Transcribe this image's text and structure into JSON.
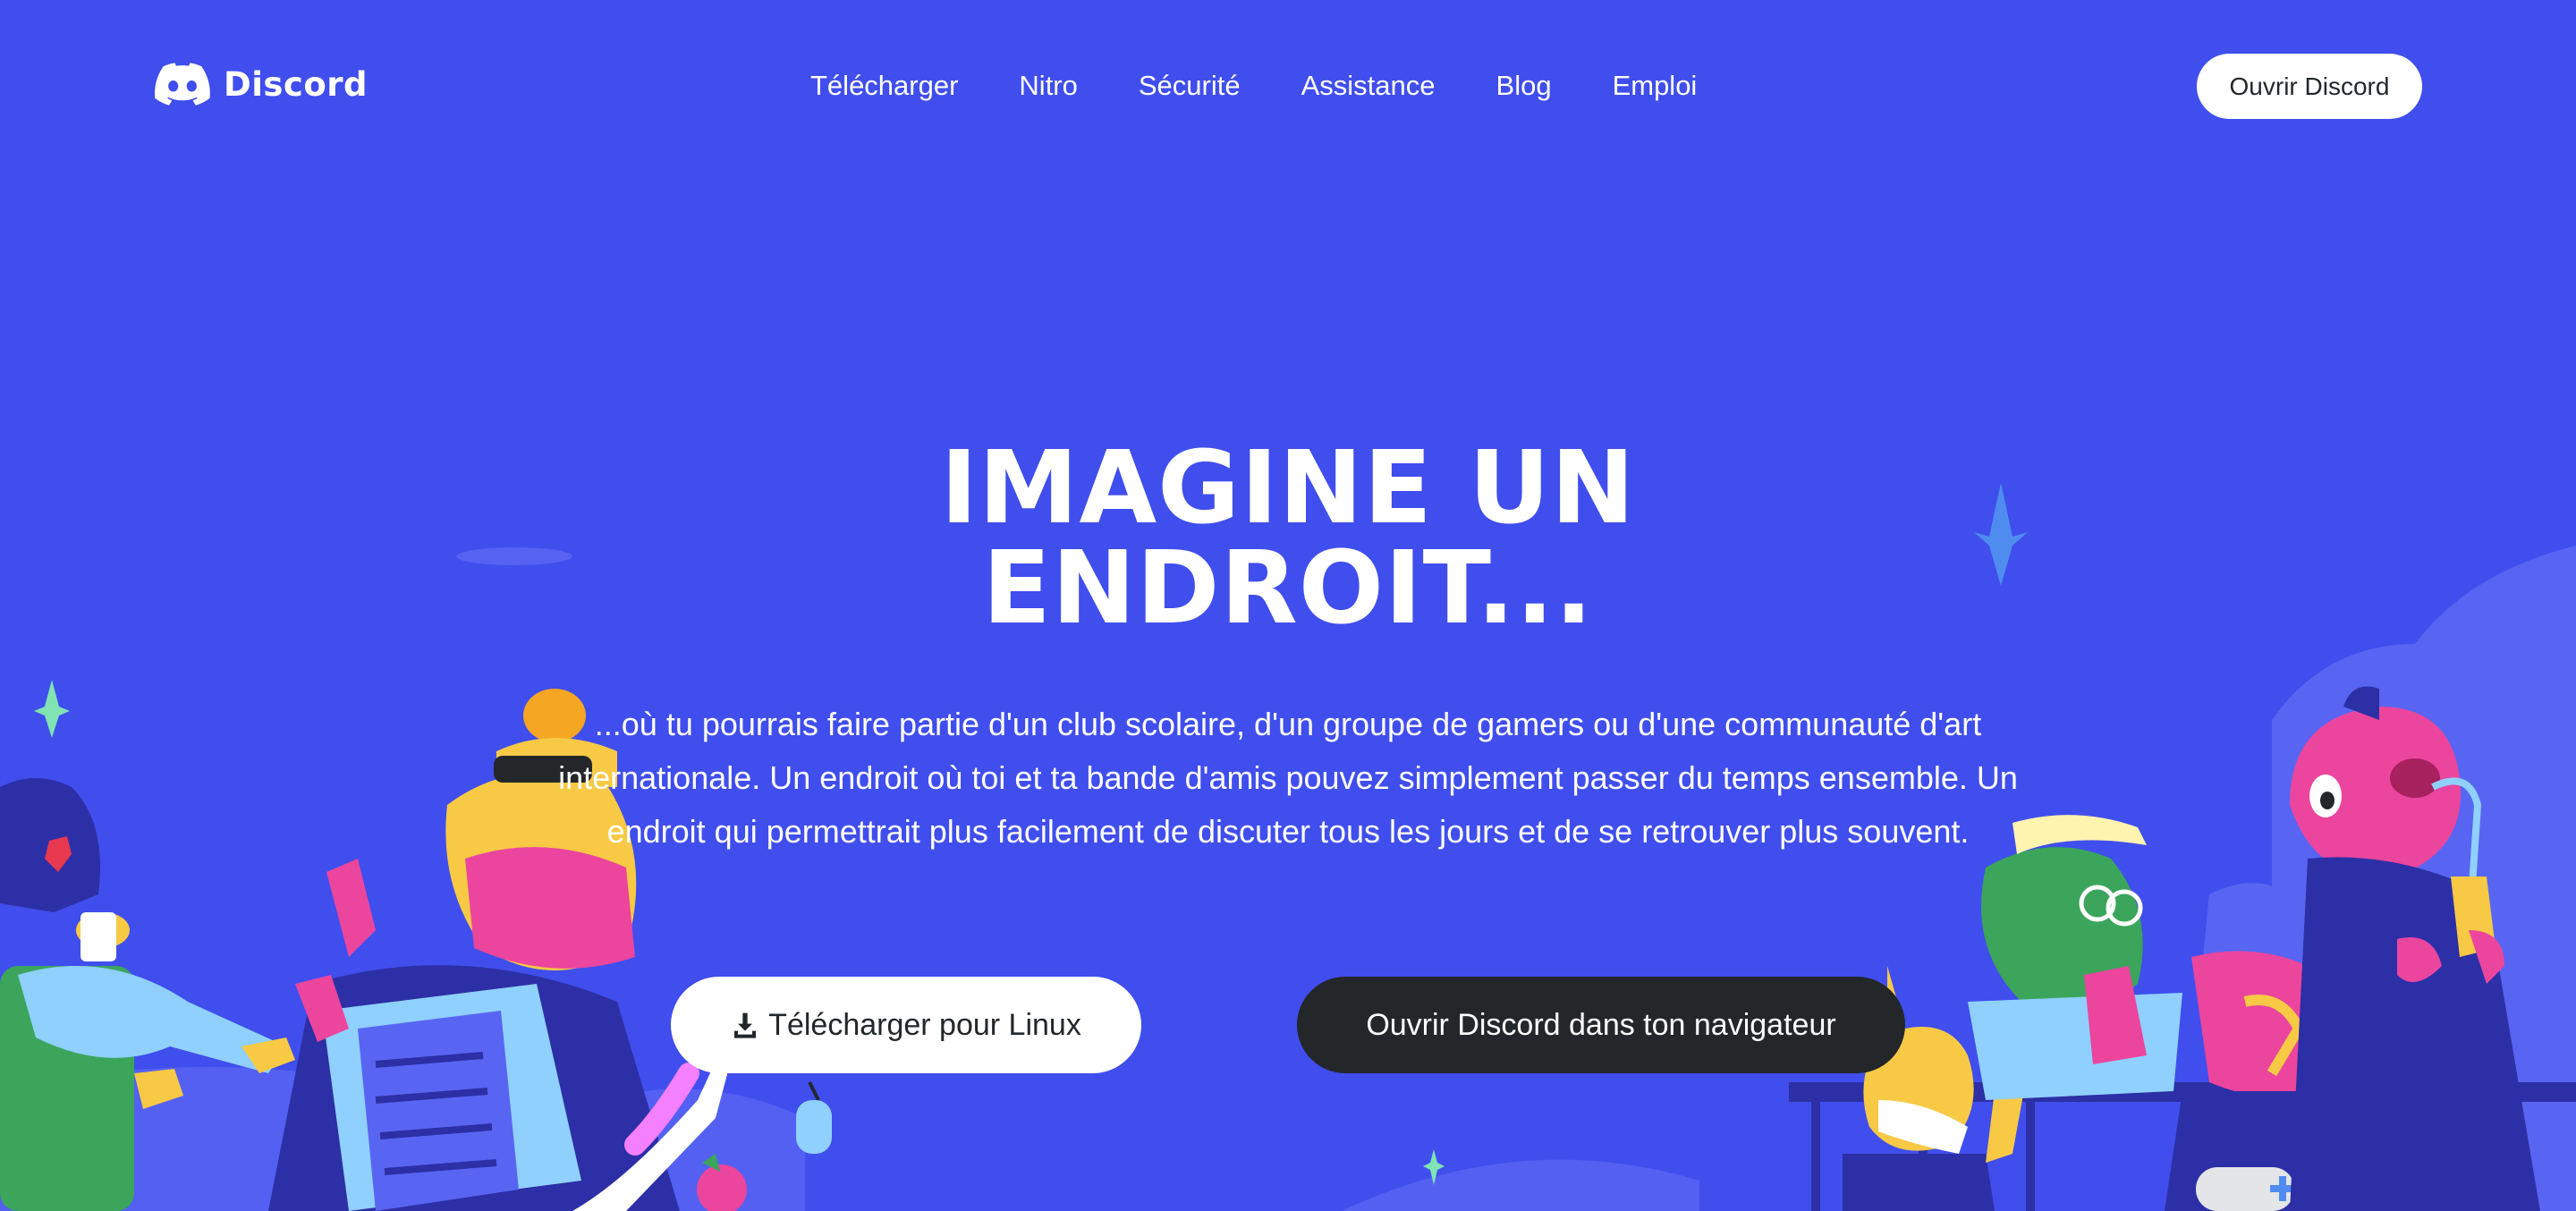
{
  "header": {
    "logo_text": "Discord",
    "nav": [
      "Télécharger",
      "Nitro",
      "Sécurité",
      "Assistance",
      "Blog",
      "Emploi"
    ],
    "open_button": "Ouvrir Discord"
  },
  "hero": {
    "title_line1": "IMAGINE UN",
    "title_line2": "ENDROIT...",
    "description": "...où tu pourrais faire partie d'un club scolaire, d'un groupe de gamers ou d'une communauté d'art internationale. Un endroit où toi et ta bande d'amis pouvez simplement passer du temps ensemble. Un endroit qui permettrait plus facilement de discuter tous les jours et de se retrouver plus souvent.",
    "download_button": "Télécharger pour Linux",
    "browser_button": "Ouvrir Discord dans ton navigateur"
  },
  "colors": {
    "background": "#404eed",
    "dark_button": "#23272a",
    "white": "#ffffff"
  },
  "icons": {
    "logo": "discord-logo-icon",
    "download": "download-icon"
  }
}
